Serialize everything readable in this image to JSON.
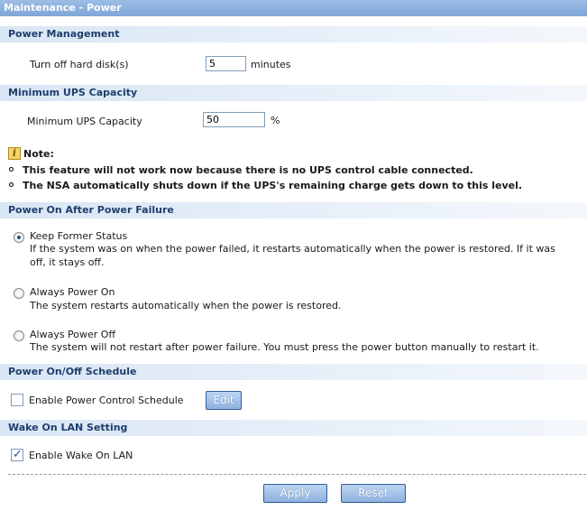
{
  "window": {
    "title": "Maintenance - Power"
  },
  "power_management": {
    "heading": "Power Management",
    "hdd_label": "Turn off hard disk(s)",
    "hdd_value": "5",
    "hdd_unit": "minutes"
  },
  "ups": {
    "heading": "Minimum UPS Capacity",
    "label": "Minimum UPS Capacity",
    "value": "50",
    "unit": "%"
  },
  "note": {
    "icon": "info-note-icon",
    "label": "Note:",
    "items": [
      "This feature will not work now because there is no UPS control cable connected.",
      "The NSA automatically shuts down if the UPS's remaining charge gets down to this level."
    ]
  },
  "power_on": {
    "heading": "Power On After Power Failure",
    "options": [
      {
        "label": "Keep Former Status",
        "desc_line1": "If the system was on when the power failed, it restarts automatically when the power is restored. If it was",
        "desc_line2": "off, it stays off.",
        "selected": true
      },
      {
        "label": "Always Power On",
        "desc_line1": "The system restarts automatically when the power is restored.",
        "selected": false
      },
      {
        "label": "Always Power Off",
        "desc_line1": "The system will not restart after power failure. You must press the power button manually to restart it.",
        "selected": false
      }
    ]
  },
  "schedule": {
    "heading": "Power On/Off Schedule",
    "checkbox_label": "Enable Power Control Schedule",
    "checked": false,
    "edit_label": "Edit"
  },
  "wol": {
    "heading": "Wake On LAN Setting",
    "checkbox_label": "Enable Wake On LAN",
    "checked": true
  },
  "actions": {
    "apply_label": "Apply",
    "reset_label": "Reset"
  }
}
